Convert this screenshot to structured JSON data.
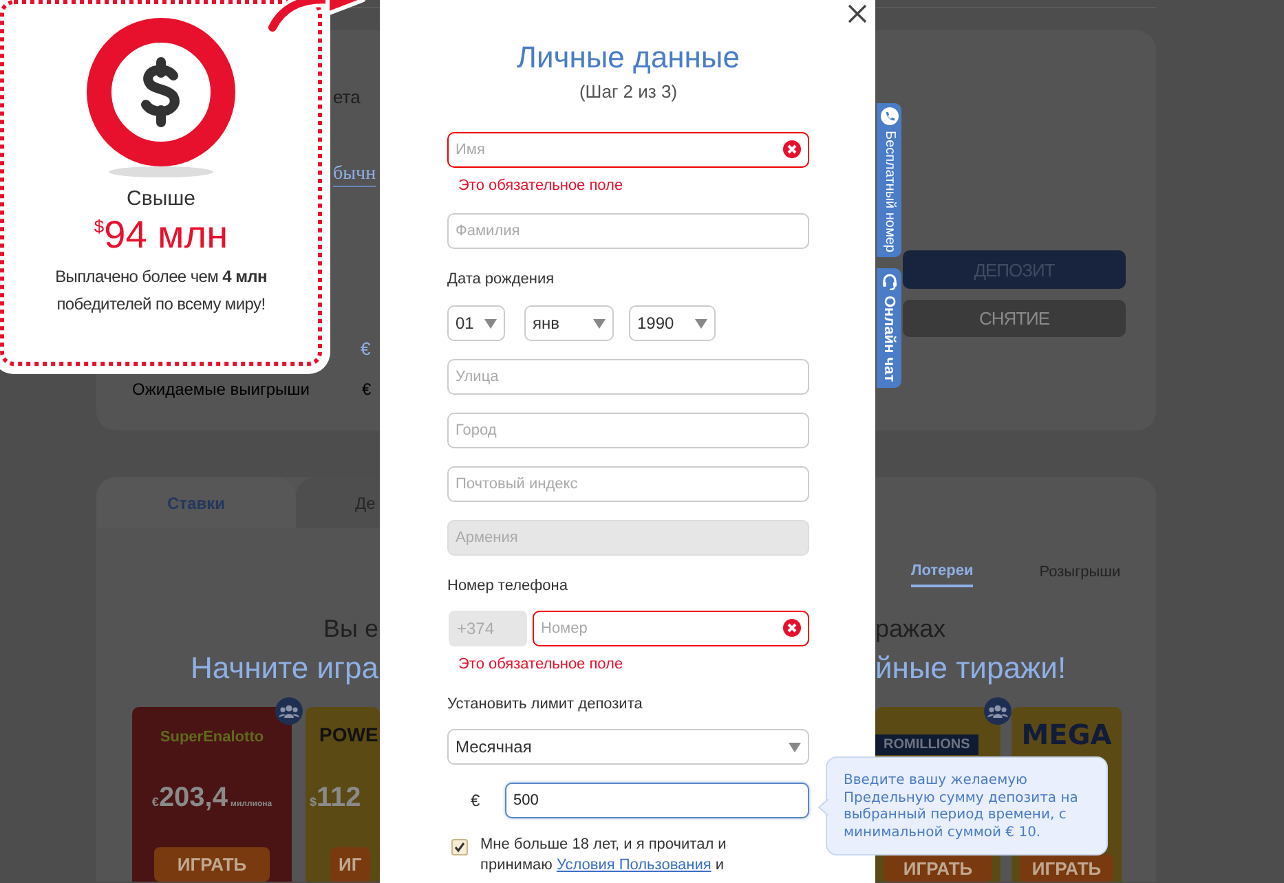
{
  "account_card": {
    "label_fragment": "ета",
    "link_fragment": "бычн",
    "balance_fragment": "€",
    "expected_label": "Ожидаемые выигрыши",
    "expected_fragment": "€",
    "buttons": [
      {
        "kind": "primary",
        "label": "ДЕПОЗИТ"
      },
      {
        "kind": "secondary",
        "label": "СНЯТИЕ"
      }
    ]
  },
  "games_card": {
    "tabs": [
      {
        "label": "Ставки",
        "selected": true
      },
      {
        "label": "Де",
        "selected": false
      }
    ],
    "filters": [
      {
        "label": "Лотереи",
        "selected": true
      },
      {
        "label": "Розыгрыши",
        "selected": false
      }
    ],
    "heading_left": "Вы е",
    "heading_right": "ражах",
    "subheading_left": "Начните игра",
    "subheading_right": "йные тиражи!",
    "lotteries_left": [
      {
        "logo": "SuperEnalotto",
        "currency": "€",
        "amount": "203,4",
        "unit": "миллиона",
        "button": "ИГРАТЬ",
        "color": "#4a1414",
        "group": true
      },
      {
        "logo": "POWE",
        "currency": "$",
        "amount": "112",
        "button": "ИГ",
        "color": "#5c4a14",
        "group": false
      }
    ],
    "lotteries_right": [
      {
        "logo": "ROMILLIONS",
        "button": "ИГРАТЬ",
        "color": "#5c4a14",
        "group": true
      },
      {
        "logo": "MEGA",
        "button": "ИГРАТЬ",
        "color": "#5c4a14",
        "group": false
      }
    ]
  },
  "promo": {
    "title": "Свыше",
    "currency": "$",
    "amount": "94 млн",
    "description": "Выплачено более чем **4 млн** победителей по всему миру!"
  },
  "side_tabs": [
    {
      "kind": "phone",
      "label": "Бесплатный номер"
    },
    {
      "kind": "chat",
      "label": "Онлайн чат"
    }
  ],
  "modal": {
    "title": "Личные данные",
    "step": "(Шаг 2 из 3)",
    "form": [
      {
        "kind": "text",
        "placeholder": "Имя",
        "error": true,
        "disabled": false,
        "error_text": "Это обязательное поле"
      },
      {
        "kind": "text",
        "placeholder": "Фамилия",
        "error": false,
        "disabled": false
      },
      {
        "kind": "label",
        "text": "Дата рождения"
      },
      {
        "kind": "date",
        "values": [
          "01",
          "янв",
          "1990"
        ]
      },
      {
        "kind": "text",
        "placeholder": "Улица",
        "error": false,
        "disabled": false
      },
      {
        "kind": "text",
        "placeholder": "Город",
        "error": false,
        "disabled": false
      },
      {
        "kind": "text",
        "placeholder": "Почтовый индекс",
        "error": false,
        "disabled": false
      },
      {
        "kind": "text",
        "placeholder": "Армения",
        "error": false,
        "disabled": true
      },
      {
        "kind": "label",
        "text": "Номер телефона"
      },
      {
        "kind": "phone",
        "prefix": "+374",
        "placeholder": "Номер",
        "error": true,
        "error_text": "Это обязательное поле"
      },
      {
        "kind": "label",
        "text": "Установить лимит депозита"
      },
      {
        "kind": "select",
        "value": "Месячная"
      },
      {
        "kind": "amount",
        "currency": "€",
        "value": "500",
        "focused": true
      },
      {
        "kind": "checkbox",
        "checked": true,
        "text_before": "Мне больше 18 лет, и я прочитал и принимаю",
        "link": "Условия Пользования",
        "text_after": "и"
      }
    ]
  },
  "tooltip": {
    "text": "Введите вашу желаемую Предельную сумму депозита на выбранный период времени, с минимальной суммой € 10."
  }
}
